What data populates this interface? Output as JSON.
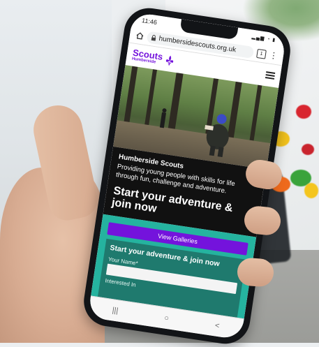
{
  "status_bar": {
    "time": "11:46",
    "icons": "signal-wifi-battery"
  },
  "browser": {
    "url": "humbersidescouts.org.uk",
    "tab_count": "1",
    "menu_icon": "kebab-menu-icon"
  },
  "site": {
    "logo_text": "Scouts",
    "logo_sub": "Humberside",
    "hero_title": "Humberside Scouts",
    "hero_body": "Providing young people with skills for life through fun, challenge and adventure.",
    "headline": "Start your adventure & join now"
  },
  "form": {
    "gallery_button": "View Galleries",
    "title": "Start your adventure & join now",
    "name_label": "Your Name*",
    "interest_label": "Interested In"
  },
  "nav": {
    "recent": "|||",
    "home": "○",
    "back": "<"
  },
  "colors": {
    "scouts_purple": "#7413dc",
    "teal": "#25b39f",
    "dark": "#111111"
  }
}
